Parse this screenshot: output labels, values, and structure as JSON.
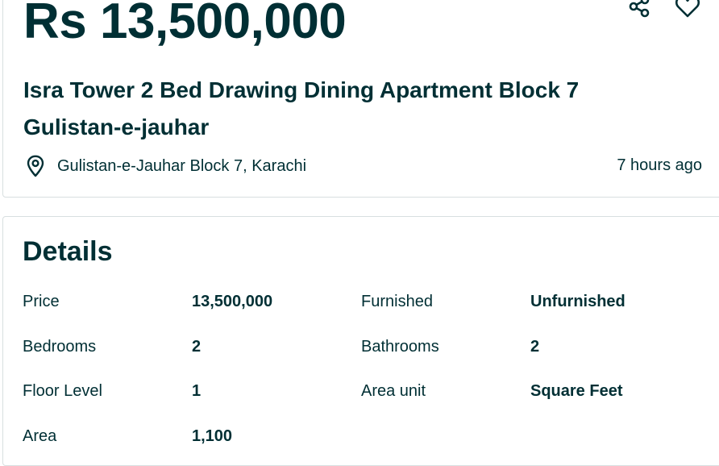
{
  "listing": {
    "price": "Rs 13,500,000",
    "title": "Isra Tower 2 Bed Drawing Dining Apartment Block 7 Gulistan-e-jauhar",
    "location": "Gulistan-e-Jauhar Block 7, Karachi",
    "posted": "7 hours ago",
    "icons": {
      "share": "share-icon",
      "favorite": "heart-icon",
      "location": "location-pin-icon"
    }
  },
  "details": {
    "heading": "Details",
    "rows": [
      {
        "label": "Price",
        "value": "13,500,000"
      },
      {
        "label": "Furnished",
        "value": "Unfurnished"
      },
      {
        "label": "Bedrooms",
        "value": "2"
      },
      {
        "label": "Bathrooms",
        "value": "2"
      },
      {
        "label": "Floor Level",
        "value": "1"
      },
      {
        "label": "Area unit",
        "value": "Square Feet"
      },
      {
        "label": "Area",
        "value": "1,100"
      }
    ]
  },
  "colors": {
    "text": "#002f34",
    "border": "#d8dfe0",
    "background": "#ffffff"
  }
}
